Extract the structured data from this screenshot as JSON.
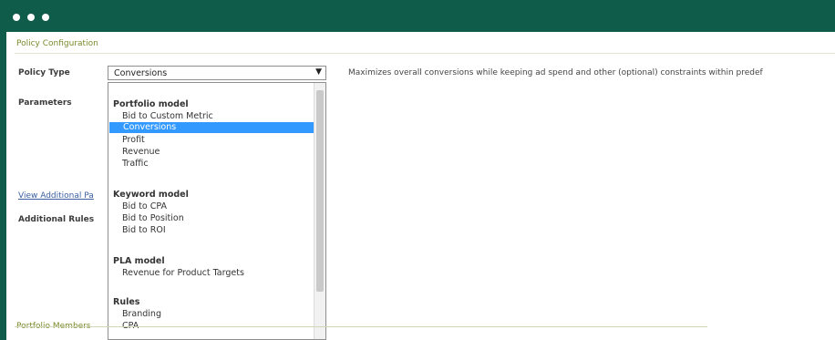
{
  "window": {
    "controls": [
      "circle-icon",
      "circle-icon",
      "circle-icon"
    ]
  },
  "section": {
    "title": "Policy Configuration"
  },
  "form": {
    "policy_type_label": "Policy Type",
    "parameters_label": "Parameters",
    "view_additional_label": "View Additional Pa",
    "additional_rules_label": "Additional Rules",
    "policy_type_value": "Conversions",
    "description": "Maximizes overall conversions while keeping ad spend and other (optional) constraints within predef"
  },
  "dropdown": {
    "groups": [
      {
        "header": "Portfolio model",
        "options": [
          "Bid to Custom Metric",
          "Conversions",
          "Profit",
          "Revenue",
          "Traffic"
        ]
      },
      {
        "header": "Keyword model",
        "options": [
          "Bid to CPA",
          "Bid to Position",
          "Bid to ROI"
        ]
      },
      {
        "header": "PLA model",
        "options": [
          "Revenue for Product Targets"
        ]
      },
      {
        "header": "Rules",
        "options": [
          "Branding",
          "CPA"
        ]
      }
    ],
    "selected": "Conversions"
  },
  "footer": {
    "section_label": "Portfolio Members"
  },
  "colors": {
    "titlebar": "#0e5c49",
    "selection": "#3399ff",
    "section_title": "#7a8a2a"
  }
}
